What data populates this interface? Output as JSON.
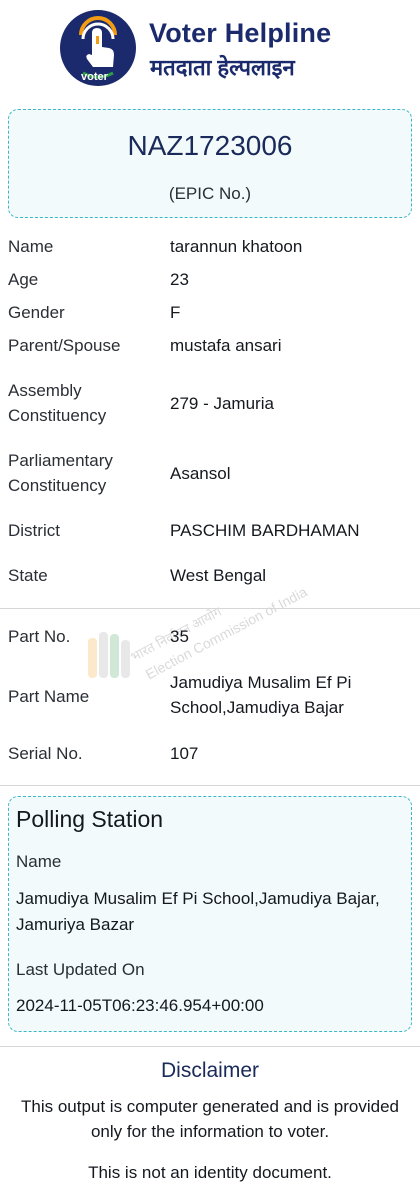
{
  "header": {
    "brand_en": "Voter Helpline",
    "brand_hi": "मतदाता हेल्पलाइन",
    "logo_caption": "voter",
    "logo_icon": "tap-hand-icon",
    "colors": {
      "brand_navy": "#1a2a6c",
      "accent_teal": "#3db7c8",
      "saffron": "#f39c12",
      "green": "#2e9b46"
    }
  },
  "epic": {
    "number": "NAZ1723006",
    "caption": "(EPIC No.)"
  },
  "details": [
    {
      "label": "Name",
      "value": "tarannun khatoon"
    },
    {
      "label": "Age",
      "value": "23"
    },
    {
      "label": "Gender",
      "value": "F"
    },
    {
      "label": "Parent/Spouse",
      "value": "mustafa ansari"
    },
    {
      "label": "Assembly Constituency",
      "value": "279 - Jamuria"
    },
    {
      "label": "Parliamentary Constituency",
      "value": "Asansol"
    },
    {
      "label": "District",
      "value": "PASCHIM BARDHAMAN"
    },
    {
      "label": "State",
      "value": "West Bengal"
    },
    {
      "label": "Part No.",
      "value": "35"
    },
    {
      "label": "Part Name",
      "value": "Jamudiya Musalim Ef Pi School,Jamudiya Bajar"
    },
    {
      "label": "Serial No.",
      "value": "107"
    }
  ],
  "watermark": {
    "line_hi": "भारत निर्वाचन आयोग",
    "line_en": "Election Commission of India"
  },
  "polling_station": {
    "title": "Polling Station",
    "name_label": "Name",
    "name": "Jamudiya Musalim Ef Pi School,Jamudiya Bajar, Jamuriya Bazar",
    "updated_label": "Last Updated On",
    "updated": "2024-11-05T06:23:46.954+00:00"
  },
  "disclaimer": {
    "title": "Disclaimer",
    "text": "This output is computer generated and is provided only for the information to voter.",
    "note": "This is not an identity document."
  }
}
